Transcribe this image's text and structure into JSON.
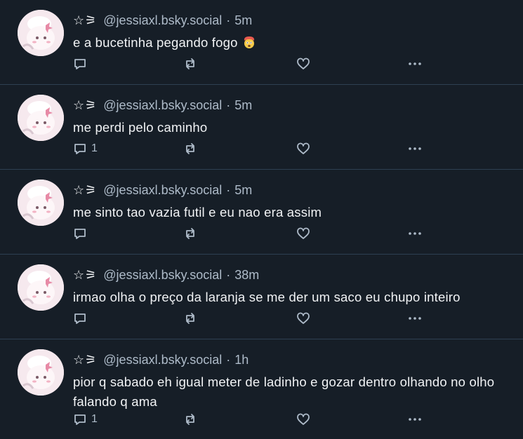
{
  "colors": {
    "background": "#161e27",
    "divider": "#2e4052",
    "text": "#f1f3f5",
    "muted": "#aebbc9"
  },
  "posts": [
    {
      "name": "☆⚞",
      "handle": "@jessiaxl.bsky.social",
      "separator": "·",
      "time": "5m",
      "text": "e a bucetinha pegando fogo",
      "emoji": "exploding-head-emoji",
      "reply_count": "",
      "icons": [
        "reply-icon",
        "repost-icon",
        "like-icon",
        "more-icon"
      ]
    },
    {
      "name": "☆⚞",
      "handle": "@jessiaxl.bsky.social",
      "separator": "·",
      "time": "5m",
      "text": "me perdi pelo caminho",
      "reply_count": "1"
    },
    {
      "name": "☆⚞",
      "handle": "@jessiaxl.bsky.social",
      "separator": "·",
      "time": "5m",
      "text": "me sinto tao vazia futil e eu nao era assim",
      "reply_count": ""
    },
    {
      "name": "☆⚞",
      "handle": "@jessiaxl.bsky.social",
      "separator": "·",
      "time": "38m",
      "text": "irmao olha o preço da laranja se me der um saco eu chupo inteiro",
      "reply_count": ""
    },
    {
      "name": "☆⚞",
      "handle": "@jessiaxl.bsky.social",
      "separator": "·",
      "time": "1h",
      "text": "pior q sabado eh igual meter de ladinho e gozar dentro olhando no olho falando q ama",
      "reply_count": "1"
    }
  ]
}
